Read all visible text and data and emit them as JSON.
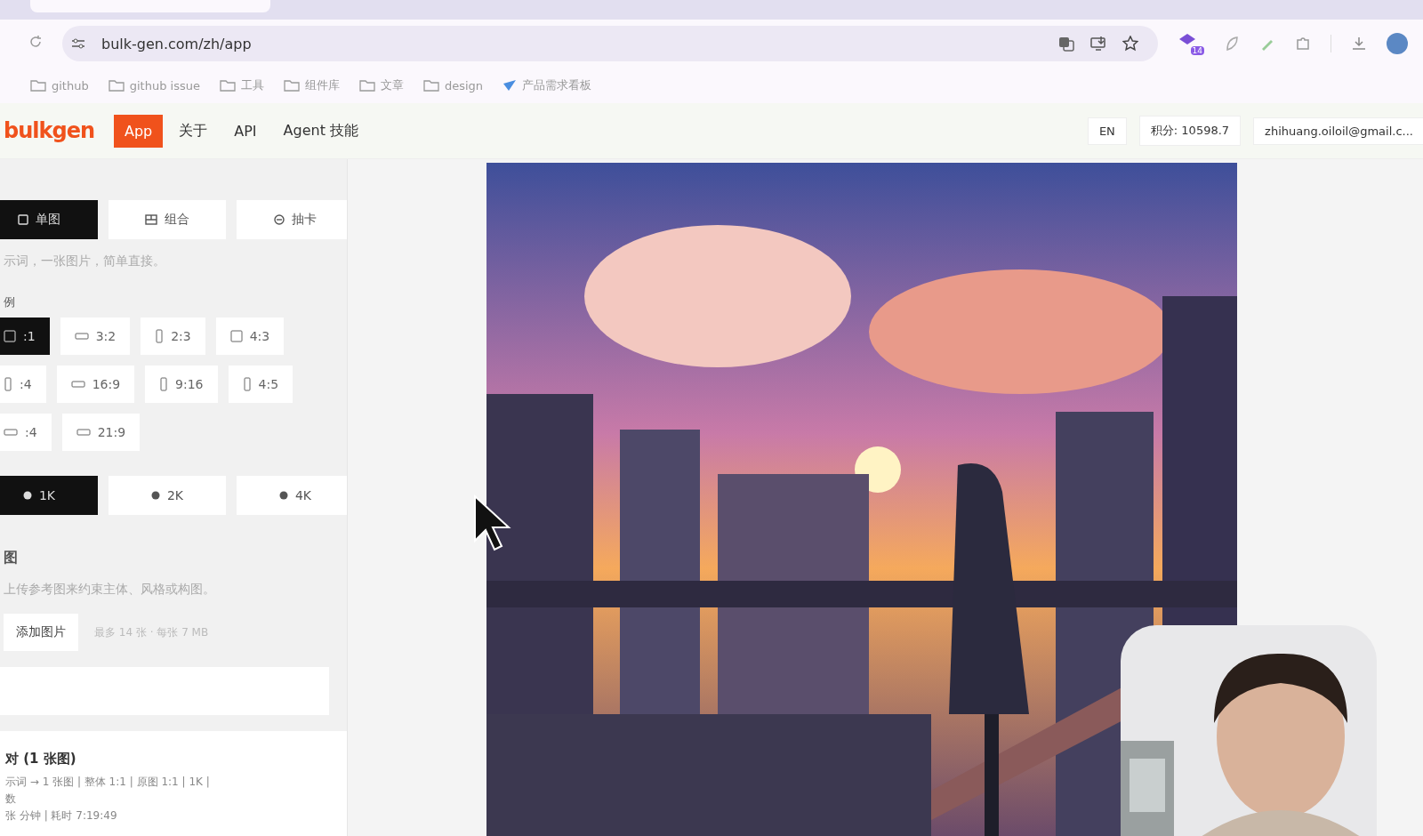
{
  "browser": {
    "url": "bulk-gen.com/zh/app",
    "extension_badge": "14",
    "bookmarks": [
      {
        "label": "github",
        "kind": "folder"
      },
      {
        "label": "github issue",
        "kind": "folder"
      },
      {
        "label": "工具",
        "kind": "folder"
      },
      {
        "label": "组件库",
        "kind": "folder"
      },
      {
        "label": "文章",
        "kind": "folder"
      },
      {
        "label": "design",
        "kind": "folder"
      },
      {
        "label": "产品需求看板",
        "kind": "app"
      }
    ]
  },
  "header": {
    "logo": "bulkgen",
    "nav": [
      {
        "label": "App",
        "selected": true
      },
      {
        "label": "关于",
        "selected": false
      },
      {
        "label": "API",
        "selected": false
      },
      {
        "label": "Agent 技能",
        "selected": false
      }
    ],
    "language": "EN",
    "credits": "积分: 10598.7",
    "account": "zhihuang.oiloil@gmail.c..."
  },
  "sidebar": {
    "mode_tabs": [
      {
        "label": "单图",
        "selected": true
      },
      {
        "label": "组合",
        "selected": false
      },
      {
        "label": "抽卡",
        "selected": false
      }
    ],
    "mode_description": "示词，一张图片，简单直接。",
    "ratio_label": "例",
    "ratio_rows": [
      [
        {
          "label": ":1",
          "kind": "square",
          "selected": true
        },
        {
          "label": "3:2",
          "kind": "wide",
          "selected": false
        },
        {
          "label": "2:3",
          "kind": "tall",
          "selected": false
        },
        {
          "label": "4:3",
          "kind": "square",
          "selected": false
        }
      ],
      [
        {
          "label": ":4",
          "kind": "tall",
          "selected": false
        },
        {
          "label": "16:9",
          "kind": "wide",
          "selected": false
        },
        {
          "label": "9:16",
          "kind": "tall",
          "selected": false
        },
        {
          "label": "4:5",
          "kind": "tall",
          "selected": false
        }
      ],
      [
        {
          "label": ":4",
          "kind": "wide",
          "selected": false
        },
        {
          "label": "21:9",
          "kind": "wide",
          "selected": false
        }
      ]
    ],
    "resolutions": [
      {
        "label": "1K",
        "selected": true
      },
      {
        "label": "2K",
        "selected": false
      },
      {
        "label": "4K",
        "selected": false
      }
    ],
    "reference": {
      "title": "图",
      "description": "上传参考图来约束主体、风格或构图。",
      "add_button": "添加图片",
      "limit": "最多 14 张 · 每张 7 MB"
    },
    "summary": {
      "title": "对 (1 张图)",
      "lines": [
        "示词 → 1 张图 | 整体 1:1 | 原图 1:1 | 1K |",
        "数",
        "张 分钟 | 耗时 7:19:49"
      ]
    }
  }
}
